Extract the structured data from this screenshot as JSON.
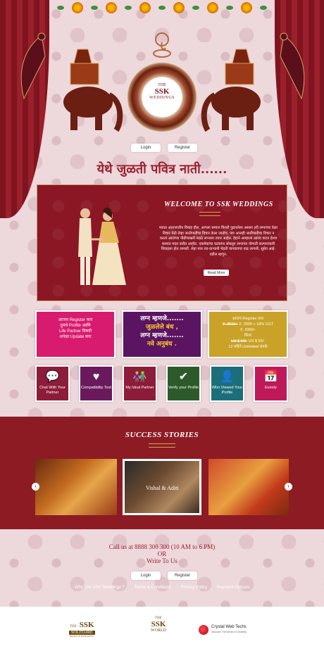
{
  "header": {
    "logo": {
      "the": "THE",
      "ssk": "SSK",
      "weddings": "WEDDINGS"
    },
    "login_label": "Login",
    "register_label": "Register",
    "tagline": "येथे जुळती पवित्र नाती......"
  },
  "welcome": {
    "title": "WELCOME TO SSK WEDDINGS",
    "body": "मराठा अंतरजातीय विवाह हौल. आपला समाज किंवरी पुढारलेला असला तरी लग्नाच्या वेळा विचार येतो तेव्हा जातीपातीचा विचार केला जातोच. पण आजही जातीपातीचा विचार न करता आजच्या पीढीचाखरी मराठे लग्नाला तयार आहेत. हेहाने आम्हाला आनंद वाटत हेश्या कामात मदत करीत आहोत. एकमेकांचा घटकांना सोबतून लग्नानंत योग्यती कल्पनावाली विवाहला होत लागली. लेहा मात्र त्या-वाऱ्यानी मेहती वागवायचा वाढ लागली, सुप्रेय आई-वडील म्हणून.",
    "read_more_label": "Read More"
  },
  "promos": {
    "p1": {
      "line1": "आजच Register करा",
      "line2": "तुमचे Profile आणि",
      "line3": "Life Partner विषयी",
      "line4": "अपेक्षा Update करा"
    },
    "p2": {
      "line1": "लग्न म्हणजे.......",
      "line2": "जुळलेले बंध ,",
      "line3": "लग्न म्हणजे.......",
      "line4": "नवे अनुबंध ."
    },
    "p3": {
      "line1": "आजच Register करा",
      "line2a": "रु. 2500/-",
      "line2b": "रु. 2000 + 18% GST",
      "line3": "रु. 2360/-",
      "line4": "किंवा",
      "line5a": "US $ 60/-",
      "line5b": "US $ 50/-",
      "line6": "12 महिने Unlimited संपर्क"
    }
  },
  "tiles": [
    {
      "label": "Chat With Your Partner",
      "icon": "chat-icon",
      "glyph": "💬",
      "color": "#8d1b3a"
    },
    {
      "label": "Compatibility Test",
      "icon": "heart-pulse-icon",
      "glyph": "♥",
      "color": "#6a1a5c"
    },
    {
      "label": "My Ideal Partner",
      "icon": "couple-icon",
      "glyph": "👫",
      "color": "#8d1b3a"
    },
    {
      "label": "Verify your Profile",
      "icon": "shield-check-icon",
      "glyph": "✔",
      "color": "#2d5a2a"
    },
    {
      "label": "Who Viewed Your Profile",
      "icon": "profile-icon",
      "glyph": "👤",
      "color": "#1c6f7a"
    },
    {
      "label": "Events",
      "icon": "calendar-icon",
      "glyph": "📅",
      "color": "#c0195a"
    }
  ],
  "stories": {
    "title": "SUCCESS STORIES",
    "featured_name": "Vishal & Aditi",
    "prev_label": "‹",
    "next_label": "›"
  },
  "contact": {
    "call_prefix": "Call us at",
    "call_number": "8888 300 300",
    "call_hours": "(10 AM to 6 PM)",
    "or": "OR",
    "write": "Write To Us",
    "login_label": "Login",
    "register_label": "Register"
  },
  "footer": {
    "links": [
      "Why The SSK Weddings ?",
      "Terms & Conditions",
      "Privacy Policy",
      "Payment Options"
    ],
    "logo1": {
      "the": "THE",
      "name": "SSK",
      "sub": "SOLITAIRE",
      "sub2": "HOTEL & BANQUETS"
    },
    "logo2": {
      "the": "THE",
      "name": "SSK",
      "sub": "WORLD"
    },
    "logo3": {
      "name": "Crystal Web Techs",
      "sub": "Discover The World of Creativity"
    }
  }
}
